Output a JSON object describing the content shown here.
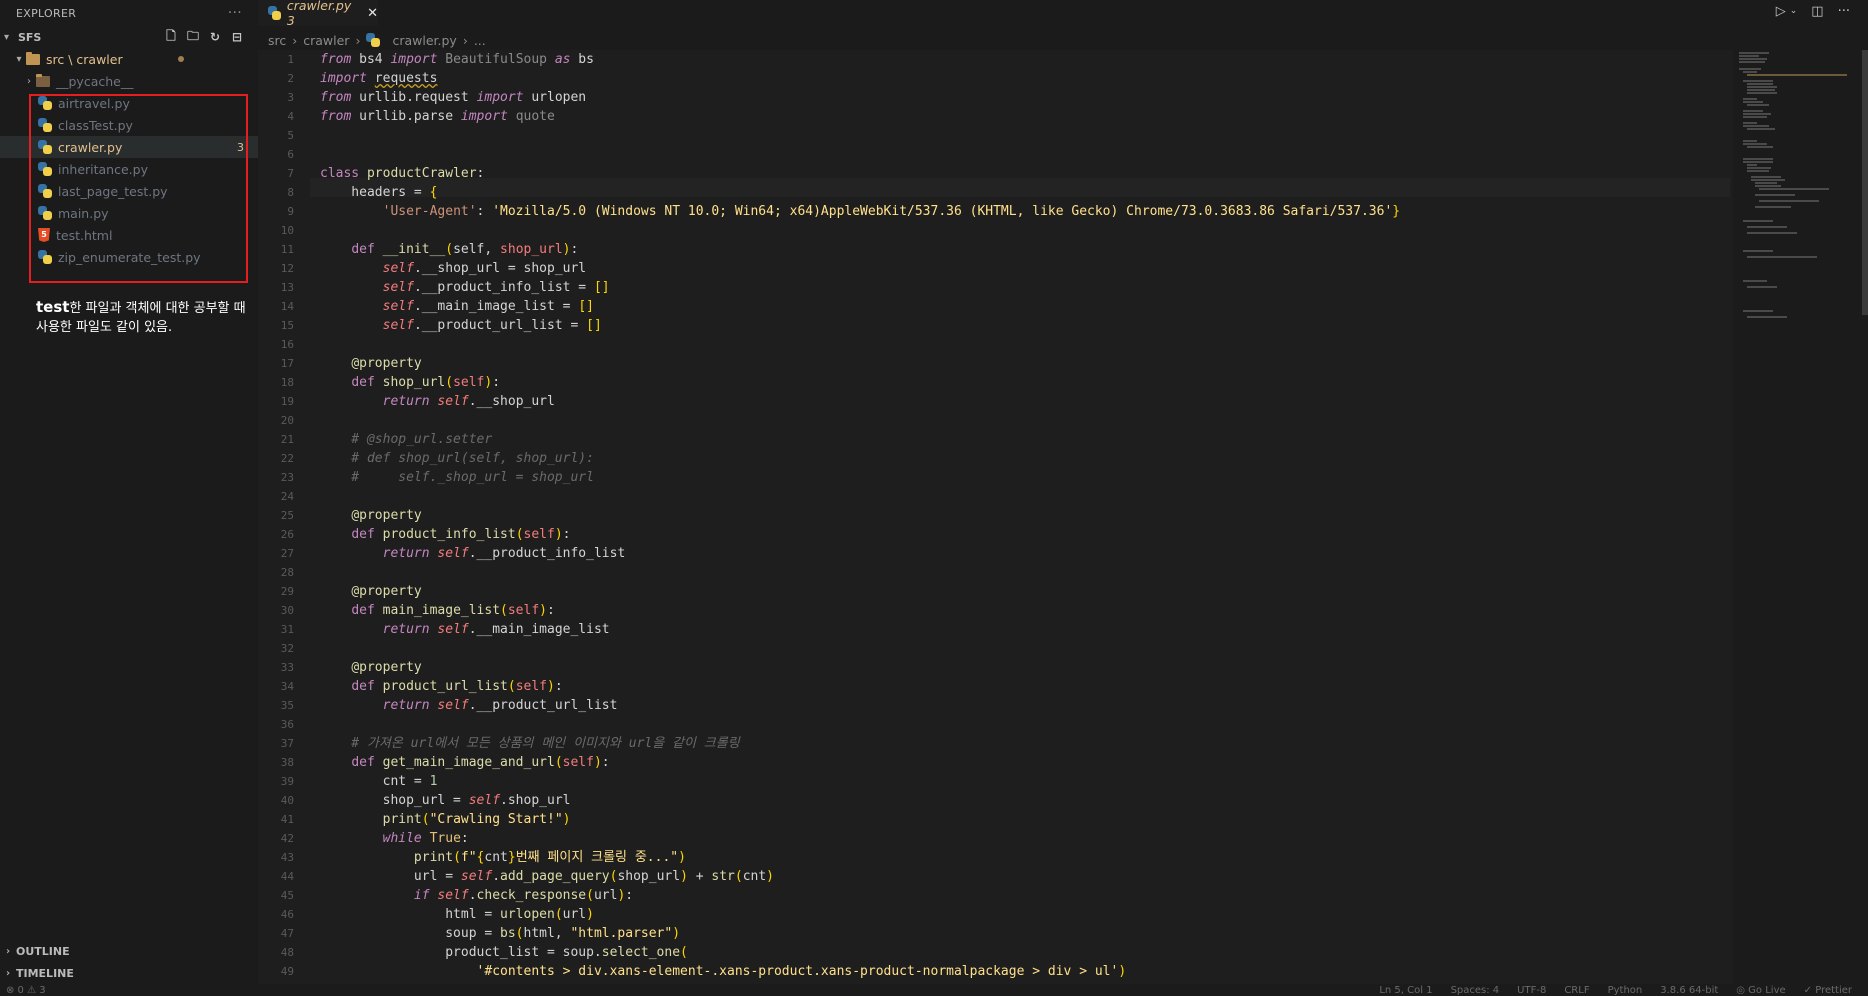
{
  "sidebar": {
    "title": "EXPLORER",
    "more": "···",
    "root": "SFS",
    "folder": "src \\ crawler",
    "subfolder": "__pycache__",
    "files": [
      {
        "name": "airtravel.py",
        "type": "py"
      },
      {
        "name": "classTest.py",
        "type": "py"
      },
      {
        "name": "crawler.py",
        "type": "py",
        "badge": "3"
      },
      {
        "name": "inheritance.py",
        "type": "py"
      },
      {
        "name": "last_page_test.py",
        "type": "py"
      },
      {
        "name": "main.py",
        "type": "py"
      },
      {
        "name": "test.html",
        "type": "html"
      },
      {
        "name": "zip_enumerate_test.py",
        "type": "py"
      }
    ],
    "annotation_bold": "test",
    "annotation_text": "한 파일과 객체에 대한 공부할 때 사용한 파일도 같이 있음.",
    "outline": "OUTLINE",
    "timeline": "TIMELINE"
  },
  "tab": {
    "label": "crawler.py 3",
    "close": "✕"
  },
  "breadcrumb": {
    "a": "src",
    "b": "crawler",
    "c": "crawler.py",
    "d": "..."
  },
  "status": {
    "left": "⊗ 0 ⚠ 3",
    "pos": "Ln 5, Col 1",
    "spaces": "Spaces: 4",
    "enc": "UTF-8",
    "eol": "CRLF",
    "lang": "Python",
    "ver": "3.8.6 64-bit",
    "live": "◎ Go Live",
    "prettier": "✓ Prettier"
  },
  "colors": {
    "highlight": "#e51f1f",
    "accent": "#e2c08d"
  }
}
